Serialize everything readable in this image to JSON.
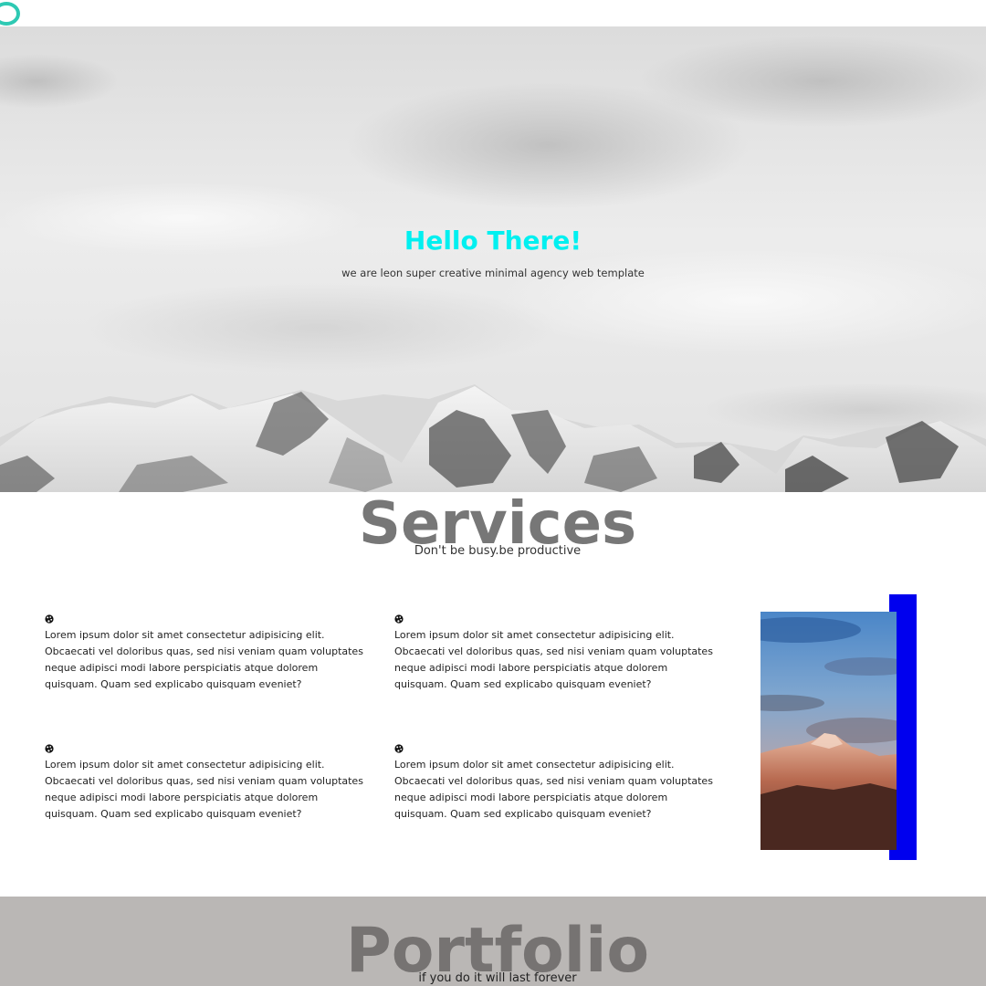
{
  "hero": {
    "title": "Hello There!",
    "subtitle": "we are leon super creative minimal agency web template"
  },
  "services": {
    "title": "Services",
    "subtitle": "Don't be busy.be productive",
    "items": [
      {
        "icon": "palette-icon",
        "text": "Lorem ipsum dolor sit amet consectetur adipisicing elit. Obcaecati vel doloribus quas, sed nisi veniam quam voluptates neque adipisci modi labore perspiciatis atque dolorem quisquam. Quam sed explicabo quisquam eveniet?"
      },
      {
        "icon": "palette-icon",
        "text": "Lorem ipsum dolor sit amet consectetur adipisicing elit. Obcaecati vel doloribus quas, sed nisi veniam quam voluptates neque adipisci modi labore perspiciatis atque dolorem quisquam. Quam sed explicabo quisquam eveniet?"
      },
      {
        "icon": "palette-icon",
        "text": "Lorem ipsum dolor sit amet consectetur adipisicing elit. Obcaecati vel doloribus quas, sed nisi veniam quam voluptates neque adipisci modi labore perspiciatis atque dolorem quisquam. Quam sed explicabo quisquam eveniet?"
      },
      {
        "icon": "palette-icon",
        "text": "Lorem ipsum dolor sit amet consectetur adipisicing elit. Obcaecati vel doloribus quas, sed nisi veniam quam voluptates neque adipisci modi labore perspiciatis atque dolorem quisquam. Quam sed explicabo quisquam eveniet?"
      }
    ]
  },
  "portfolio": {
    "title": "Portfolio",
    "subtitle": "if you do it will last forever"
  },
  "colors": {
    "accent_cyan": "#00f0f0",
    "accent_blue": "#0000ee",
    "loader": "#2ec9b3",
    "portfolio_bg": "#bab7b5"
  }
}
